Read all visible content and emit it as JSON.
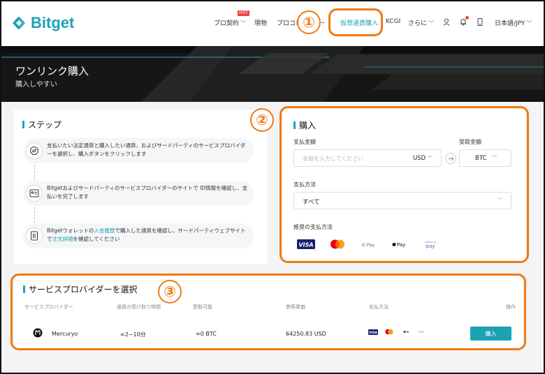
{
  "brand": {
    "name": "Bitget",
    "accent": "#1da2b4",
    "annotation_color": "#f07a10"
  },
  "nav": {
    "futures": "プロ契約",
    "hot_badge": "HOT",
    "spot": "現物",
    "copy_trade": "プロコピートレード",
    "buy_crypto": "仮想通貨購入",
    "kcgi": "KCGI",
    "more": "さらに",
    "language": "日本語/JPY"
  },
  "hero": {
    "title": "ワンリンク購入",
    "subtitle": "購入しやすい"
  },
  "steps": {
    "title": "ステップ",
    "items": [
      {
        "text": "支払いたい法定通貨と購入したい通貨、およびサードパーティのサービスプロバイダーを選択し、購入ボタンをクリックします"
      },
      {
        "text": "Bitgetおよびサードパーティのサービスプロバイダーのサイトで ID情報を確認し、支払いを完了します"
      },
      {
        "text_a": "Bitgetウォレットの",
        "link_a": "入金履歴",
        "text_b": "で購入した通貨を確認し、サードパーティウェブサイトで",
        "link_b": "注文詳細",
        "text_c": "を確認してください"
      }
    ]
  },
  "purchase": {
    "title": "購入",
    "pay_label": "支払金額",
    "receive_label": "受取金額",
    "amount_placeholder": "金額を入力してください",
    "fiat": "USD",
    "crypto": "BTC",
    "method_label": "支払方法",
    "method_value": "すべて",
    "recommended_label": "推奨の支払方法",
    "methods": [
      "VISA",
      "Mastercard",
      "G Pay",
      "Apple Pay",
      "Samsung Pay"
    ]
  },
  "providers": {
    "title": "サービスプロバイダーを選択",
    "columns": [
      "サービスプロバイダー",
      "通貨の受け取り時間",
      "受取可能",
      "参照単価",
      "支払方法",
      "操作"
    ],
    "rows": [
      {
        "name": "Mercuryo",
        "time": "≈2~10分",
        "receivable": "≈0 BTC",
        "price": "64250.83 USD",
        "buy": "購入"
      }
    ]
  },
  "annotations": [
    "①",
    "②",
    "③"
  ]
}
